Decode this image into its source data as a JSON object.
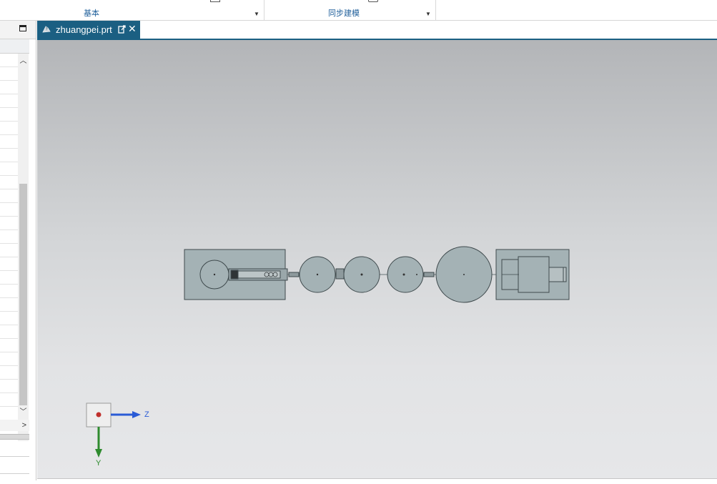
{
  "ribbon": {
    "groups": [
      {
        "label": "基本"
      },
      {
        "label": "同步建模"
      }
    ]
  },
  "tab": {
    "title": "zhuangpei.prt"
  },
  "triad": {
    "z_label": "Z",
    "y_label": "Y"
  },
  "icons": {
    "tab": [
      "part-file-icon",
      "popout-icon",
      "close-icon"
    ],
    "panel": [
      "maximize-icon",
      "scroll-up-icon",
      "scroll-down-icon",
      "scroll-right-icon"
    ]
  },
  "colors": {
    "tab_active": "#1b5f82",
    "ribbon_label": "#1f5f9a",
    "part_fill": "#a4b2b5",
    "axis_z": "#2a5bd6",
    "axis_y": "#2e8b2e",
    "origin_marker": "#c0302c"
  }
}
